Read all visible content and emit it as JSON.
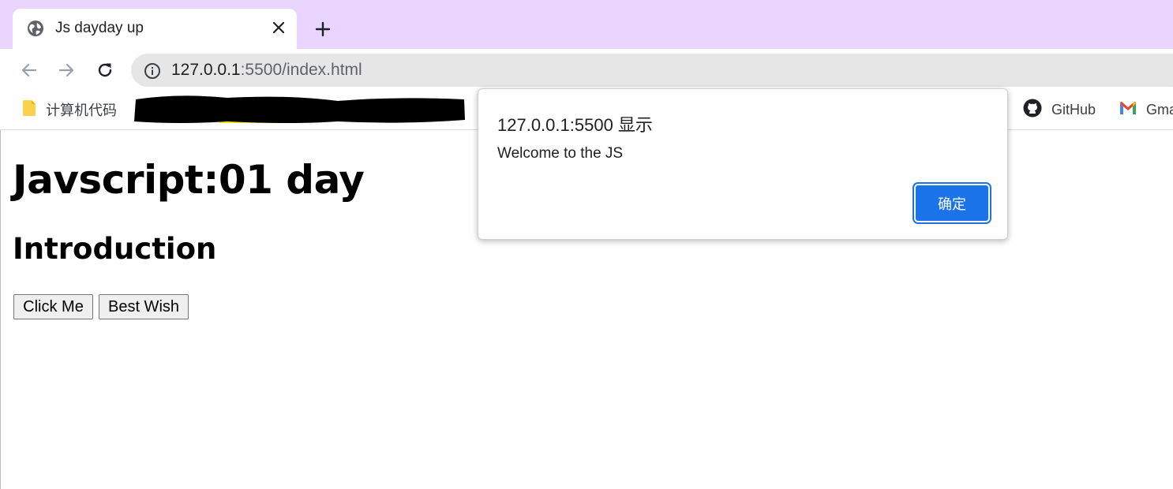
{
  "tab": {
    "title": "Js dayday up"
  },
  "address_bar": {
    "url_host": "127.0.0.1",
    "url_rest": ":5500/index.html"
  },
  "bookmarks": [
    {
      "label": "计算机代码",
      "icon": "folder-icon"
    },
    {
      "label": "GitHub",
      "icon": "github-icon"
    },
    {
      "label": "Gma",
      "icon": "gmail-icon"
    }
  ],
  "page": {
    "heading": "Javscript:01 day",
    "subheading": "Introduction",
    "buttons": [
      "Click Me",
      "Best Wish"
    ]
  },
  "dialog": {
    "title": "127.0.0.1:5500 显示",
    "message": "Welcome to the JS",
    "ok_label": "确定"
  },
  "colors": {
    "tabstrip": "#e9d5ff",
    "accent": "#1a73e8"
  }
}
